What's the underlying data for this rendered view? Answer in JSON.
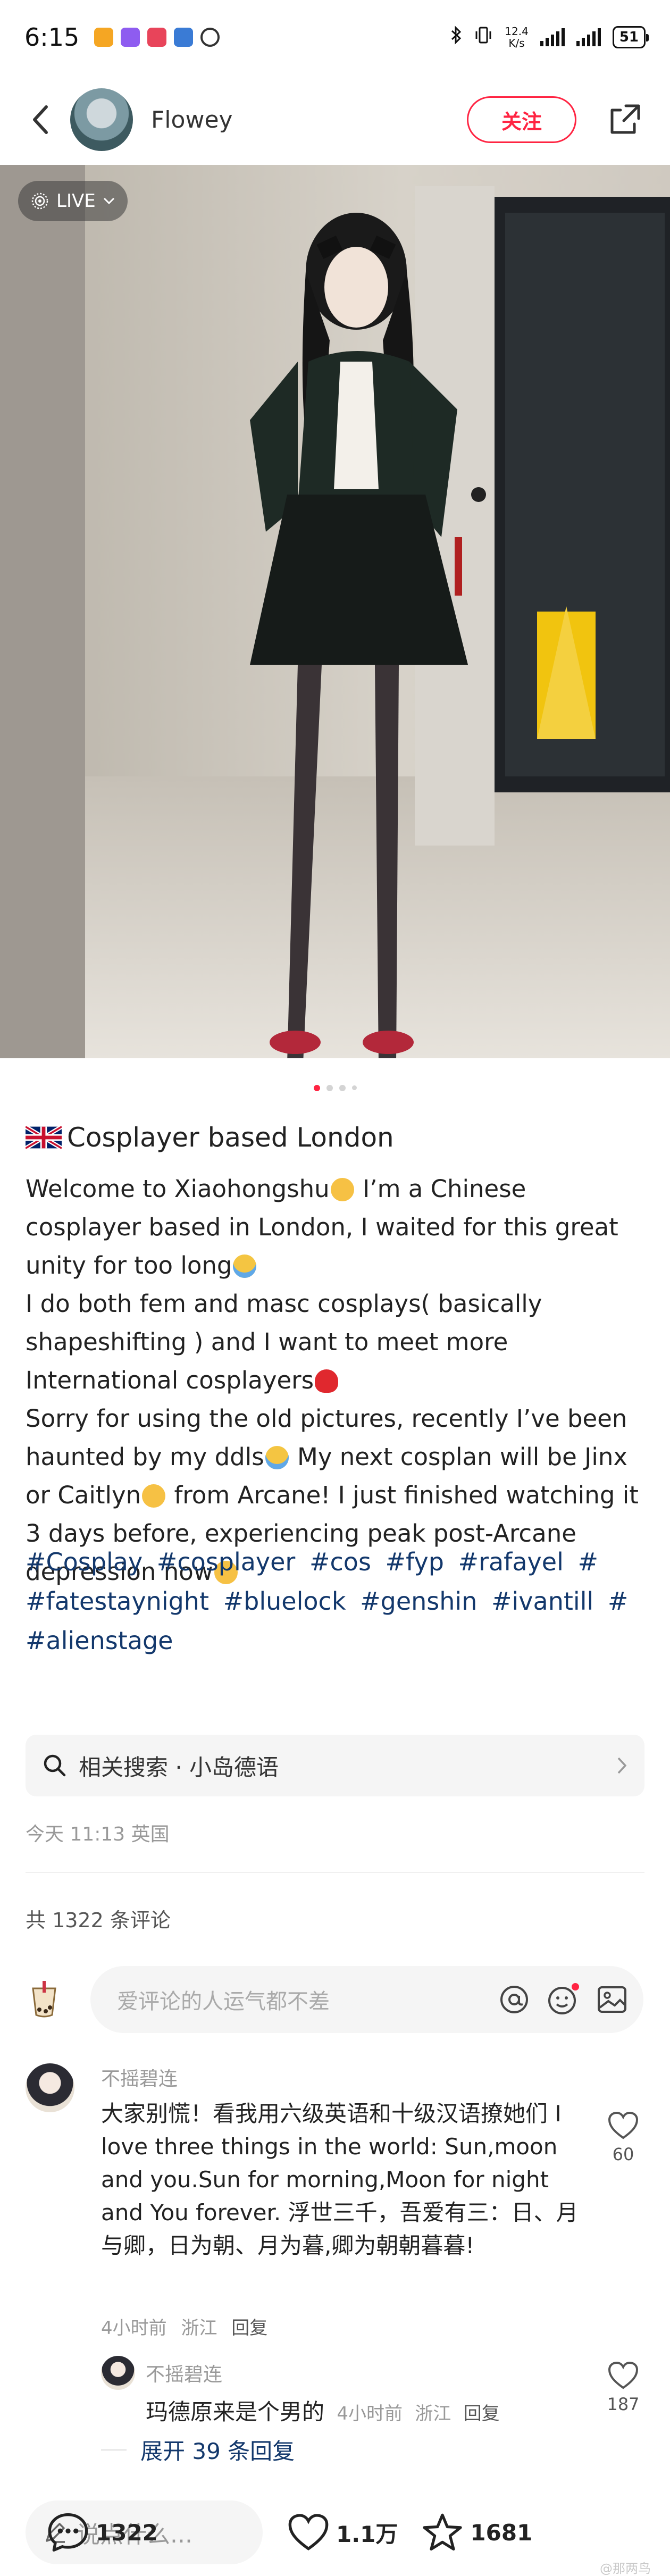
{
  "status_bar": {
    "time": "6:15",
    "net_speed_value": "12.4",
    "net_speed_unit": "K/s",
    "battery": "51"
  },
  "header": {
    "author": "Flowey",
    "follow_label": "关注"
  },
  "photo": {
    "live_label": "LIVE",
    "page_count": 4,
    "current_page": 1
  },
  "note": {
    "title": "Cosplayer based London",
    "paragraphs": [
      [
        "Welcome to Xiaohongshu",
        " I’m a Chinese cosplayer based in London, I waited for this great unity for too long"
      ],
      [
        "I do both fem and masc cosplays( basically shapeshifting ) and I want to meet more International cosplayers"
      ],
      [
        "Sorry for using the old pictures, recently I’ve been haunted by my ddls",
        " My next cosplan will be Jinx or Caitlyn",
        " from Arcane! I just finished watching it  3 days before, experiencing peak post-Arcane depression now"
      ]
    ],
    "tags": [
      "#Cosplay",
      "#cosplayer",
      "#cos",
      "#fyp",
      "#rafayel",
      "#",
      "#fatestaynight",
      "#bluelock",
      "#genshin",
      "#ivantill",
      "#",
      "#alienstage"
    ]
  },
  "related_search": {
    "label": "相关搜索 · 小岛德语"
  },
  "post_meta": "今天 11:13 英国",
  "comments_header": "共 1322 条评论",
  "comment_input": {
    "placeholder": "爱评论的人运气都不差"
  },
  "comments": [
    {
      "author": "不摇碧连",
      "text": "大家别慌！看我用六级英语和十级汉语撩她们 I love three things in the world: Sun,moon and you.Sun for morning,Moon for night and You forever. 浮世三千，吾爱有三：日、月与卿，日为朝、月为暮,卿为朝朝暮暮!",
      "time": "4小时前",
      "location": "浙江",
      "reply_label": "回复",
      "likes": "60",
      "replies": [
        {
          "author": "不摇碧连",
          "text": "玛德原来是个男的",
          "time": "4小时前",
          "location": "浙江",
          "reply_label": "回复",
          "likes": "187"
        }
      ],
      "expand_label": "展开 39 条回复"
    }
  ],
  "bottom_bar": {
    "say_placeholder": "说点什么...",
    "likes": "1.1万",
    "collects": "1681",
    "comments": "1322"
  },
  "watermark": "@那两鸟",
  "colors": {
    "brand": "#ff2442",
    "tag": "#13386c",
    "muted": "#999999"
  }
}
